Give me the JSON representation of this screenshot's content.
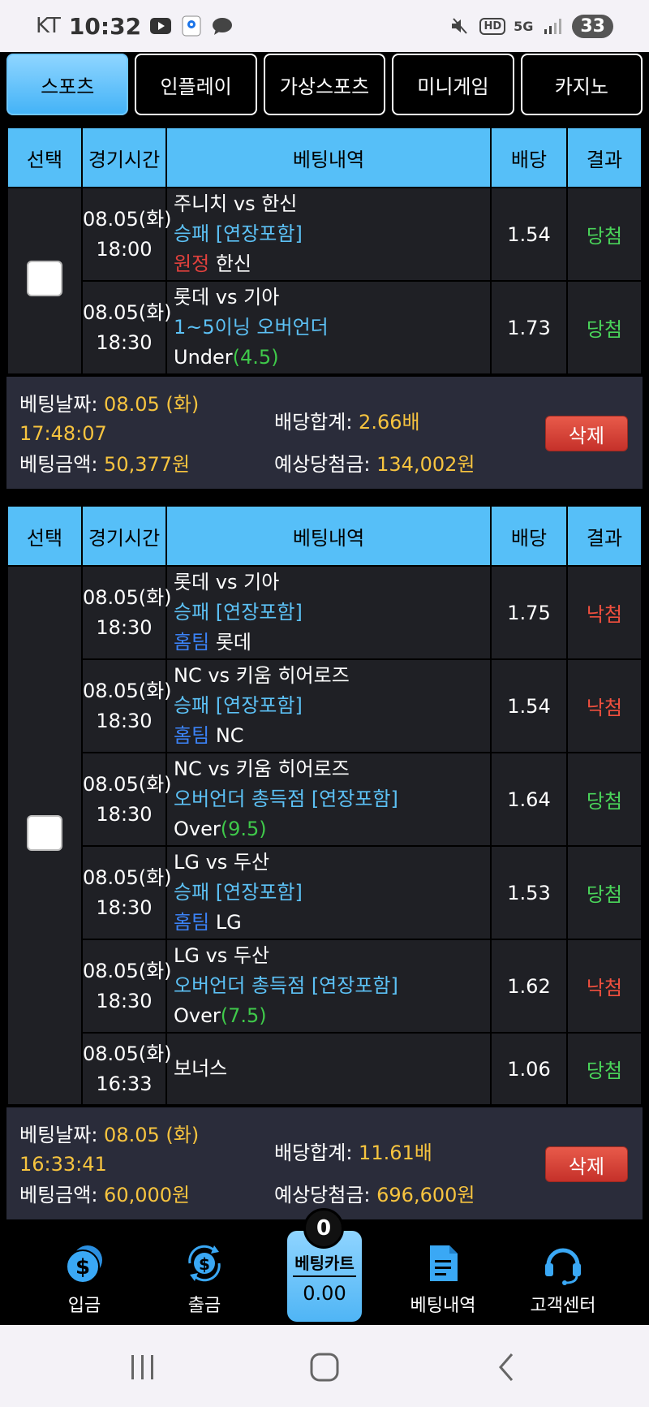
{
  "status": {
    "carrier": "KT",
    "time": "10:32",
    "network": "5G",
    "hd": "HD",
    "battery": "33"
  },
  "tabs": [
    {
      "label": "스포츠",
      "active": true
    },
    {
      "label": "인플레이",
      "active": false
    },
    {
      "label": "가상스포츠",
      "active": false
    },
    {
      "label": "미니게임",
      "active": false
    },
    {
      "label": "카지노",
      "active": false
    }
  ],
  "table_headers": {
    "select": "선택",
    "time": "경기시간",
    "detail": "베팅내역",
    "odds": "배당",
    "result": "결과"
  },
  "bets": [
    {
      "rows": [
        {
          "date": "08.05(화)",
          "time": "18:00",
          "match": "주니치 vs 한신",
          "market": "승패 [연장포함]",
          "pick_tag": "원정",
          "pick": "한신",
          "odds": "1.54",
          "result": "당첨"
        },
        {
          "date": "08.05(화)",
          "time": "18:30",
          "match": "롯데 vs 기아",
          "market": "1~5이닝 오버언더",
          "pick_tag": "Under",
          "pick": "(4.5)",
          "odds": "1.73",
          "result": "당첨"
        }
      ],
      "summary": {
        "date_label": "베팅날짜:",
        "date_value": "08.05 (화)",
        "time_value": "17:48:07",
        "amount_label": "베팅금액:",
        "amount_value": "50,377원",
        "total_label": "배당합계:",
        "total_value": "2.66배",
        "expect_label": "예상당첨금:",
        "expect_value": "134,002원",
        "delete_label": "삭제"
      }
    },
    {
      "rows": [
        {
          "date": "08.05(화)",
          "time": "18:30",
          "match": "롯데 vs 기아",
          "market": "승패 [연장포함]",
          "pick_tag": "홈팀",
          "pick": "롯데",
          "odds": "1.75",
          "result": "낙첨"
        },
        {
          "date": "08.05(화)",
          "time": "18:30",
          "match": "NC vs 키움 히어로즈",
          "market": "승패 [연장포함]",
          "pick_tag": "홈팀",
          "pick": "NC",
          "odds": "1.54",
          "result": "낙첨"
        },
        {
          "date": "08.05(화)",
          "time": "18:30",
          "match": "NC vs 키움 히어로즈",
          "market": "오버언더 총득점 [연장포함]",
          "pick_tag": "Over",
          "pick": "(9.5)",
          "odds": "1.64",
          "result": "당첨"
        },
        {
          "date": "08.05(화)",
          "time": "18:30",
          "match": "LG vs 두산",
          "market": "승패 [연장포함]",
          "pick_tag": "홈팀",
          "pick": "LG",
          "odds": "1.53",
          "result": "당첨"
        },
        {
          "date": "08.05(화)",
          "time": "18:30",
          "match": "LG vs 두산",
          "market": "오버언더 총득점 [연장포함]",
          "pick_tag": "Over",
          "pick": "(7.5)",
          "odds": "1.62",
          "result": "낙첨"
        },
        {
          "date": "08.05(화)",
          "time": "16:33",
          "match": "보너스",
          "market": "",
          "pick_tag": "",
          "pick": "",
          "odds": "1.06",
          "result": "당첨"
        }
      ],
      "summary": {
        "date_label": "베팅날짜:",
        "date_value": "08.05 (화)",
        "time_value": "16:33:41",
        "amount_label": "베팅금액:",
        "amount_value": "60,000원",
        "total_label": "배당합계:",
        "total_value": "11.61배",
        "expect_label": "예상당첨금:",
        "expect_value": "696,600원",
        "delete_label": "삭제"
      }
    }
  ],
  "bottom_nav": {
    "deposit": "입금",
    "withdraw": "출금",
    "cart_label": "베팅카트",
    "cart_value": "0.00",
    "cart_count": "0",
    "history": "베팅내역",
    "support": "고객센터"
  },
  "colors": {
    "accent": "#56bff8",
    "win": "#4ad45a",
    "lose": "#f04f3e",
    "amount": "#f7c43f"
  }
}
